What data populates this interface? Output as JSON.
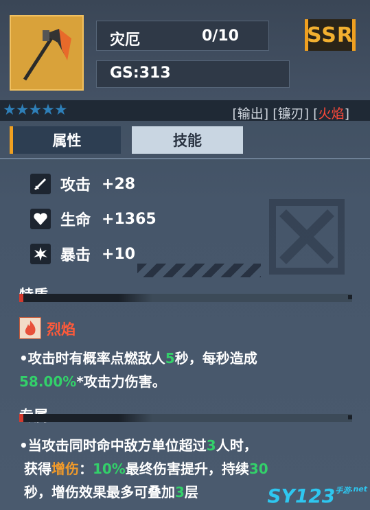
{
  "item": {
    "name": "灾厄",
    "level": "0/10",
    "gs": "GS:313",
    "rarity": "SSR",
    "stars": "★★★★★"
  },
  "tags": {
    "open1": "[",
    "t1": "输出",
    "close1": "] [",
    "t2": "镰刃",
    "close2": "] [",
    "t3": "火焰",
    "close3": "]"
  },
  "tabs": {
    "attributes": "属性",
    "skills": "技能"
  },
  "stats": [
    {
      "label": "攻击",
      "value": "+28",
      "icon": "sword-icon"
    },
    {
      "label": "生命",
      "value": "+1365",
      "icon": "heart-icon"
    },
    {
      "label": "暴击",
      "value": "+10",
      "icon": "burst-icon"
    }
  ],
  "trait": {
    "heading": "特质",
    "name": "烈焰",
    "icon": "flame-icon",
    "line1_a": "•攻击时有概率点燃敌人",
    "line1_b": "5",
    "line1_c": "秒，每秒造成",
    "line2_a": "58.00%",
    "line2_b": "*攻击力伤害。"
  },
  "exclusive": {
    "heading": "专属",
    "l1_a": "•当攻击同时命中敌方单位超过",
    "l1_b": "3",
    "l1_c": "人时，",
    "l2_a": "获得",
    "l2_b": "增伤",
    "l2_c": "：",
    "l2_d": "10%",
    "l2_e": "最终伤害提升，持续",
    "l2_f": "30",
    "l3_a": "秒，增伤效果最多可叠加",
    "l3_b": "3",
    "l3_c": "层"
  },
  "watermark": {
    "logo": "SY123",
    "sub": "手游",
    "net": ".net"
  },
  "colors": {
    "accent": "#f0a020",
    "fire": "#ff4a3a",
    "green": "#33d06a",
    "orange": "#f09a2a",
    "skill_tab": "#c9d6e2"
  }
}
